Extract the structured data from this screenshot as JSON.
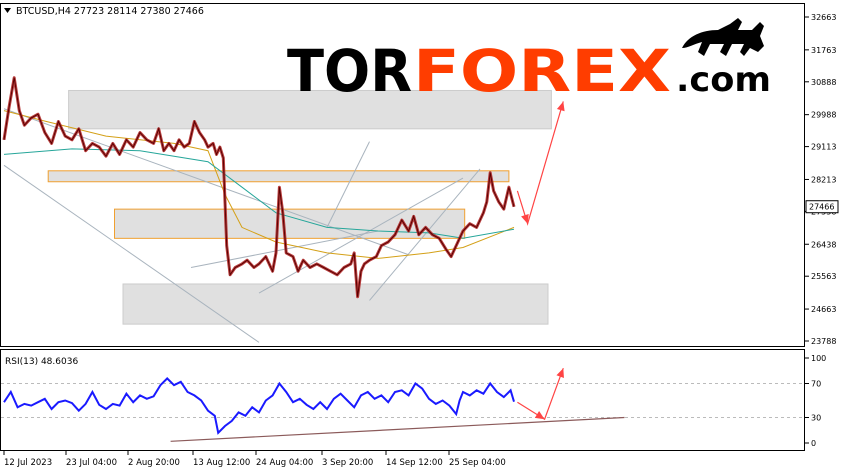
{
  "chart_data": [
    {
      "type": "candlestick",
      "symbol_info": "BTCUSD,H4  27723 28114 27380 27466",
      "last_price_label": "27466",
      "y_ticks": [
        "32663",
        "31763",
        "30888",
        "29988",
        "29113",
        "28213",
        "27338",
        "26438",
        "25563",
        "24663",
        "23788"
      ],
      "ylim": [
        23788,
        32663
      ],
      "x_ticks": [
        "12 Jul 2023",
        "23 Jul 04:00",
        "2 Aug 20:00",
        "13 Aug 12:00",
        "24 Aug 04:00",
        "3 Sep 20:00",
        "14 Sep 12:00",
        "25 Sep 04:00"
      ],
      "price_path": [
        [
          0,
          29300
        ],
        [
          3,
          30200
        ],
        [
          6,
          31000
        ],
        [
          9,
          30100
        ],
        [
          12,
          29700
        ],
        [
          16,
          29900
        ],
        [
          20,
          30000
        ],
        [
          24,
          29500
        ],
        [
          28,
          29200
        ],
        [
          32,
          29800
        ],
        [
          36,
          29400
        ],
        [
          40,
          29300
        ],
        [
          44,
          29600
        ],
        [
          48,
          29000
        ],
        [
          52,
          29200
        ],
        [
          56,
          29100
        ],
        [
          60,
          28850
        ],
        [
          64,
          29200
        ],
        [
          68,
          28900
        ],
        [
          72,
          29300
        ],
        [
          76,
          29100
        ],
        [
          80,
          29500
        ],
        [
          84,
          29300
        ],
        [
          88,
          29200
        ],
        [
          91,
          29600
        ],
        [
          94,
          29000
        ],
        [
          97,
          29200
        ],
        [
          100,
          29000
        ],
        [
          103,
          29300
        ],
        [
          106,
          29100
        ],
        [
          109,
          29200
        ],
        [
          112,
          29800
        ],
        [
          115,
          29500
        ],
        [
          118,
          29300
        ],
        [
          120,
          29100
        ],
        [
          123,
          29200
        ],
        [
          125,
          28900
        ],
        [
          127,
          29100
        ],
        [
          129,
          28800
        ],
        [
          131,
          26400
        ],
        [
          133,
          25600
        ],
        [
          136,
          25800
        ],
        [
          140,
          25900
        ],
        [
          143,
          26000
        ],
        [
          147,
          25800
        ],
        [
          150,
          25900
        ],
        [
          154,
          26100
        ],
        [
          158,
          25700
        ],
        [
          160,
          26200
        ],
        [
          162,
          28000
        ],
        [
          164,
          27300
        ],
        [
          166,
          26200
        ],
        [
          170,
          26100
        ],
        [
          173,
          25700
        ],
        [
          176,
          26000
        ],
        [
          180,
          25800
        ],
        [
          184,
          25900
        ],
        [
          188,
          25800
        ],
        [
          192,
          25700
        ],
        [
          196,
          25600
        ],
        [
          200,
          25800
        ],
        [
          204,
          25900
        ],
        [
          206,
          26200
        ],
        [
          208,
          25000
        ],
        [
          210,
          25700
        ],
        [
          212,
          25900
        ],
        [
          215,
          26000
        ],
        [
          219,
          26100
        ],
        [
          222,
          26400
        ],
        [
          226,
          26500
        ],
        [
          230,
          26700
        ],
        [
          234,
          27100
        ],
        [
          238,
          26800
        ],
        [
          241,
          27200
        ],
        [
          244,
          26700
        ],
        [
          248,
          26900
        ],
        [
          252,
          26700
        ],
        [
          256,
          26600
        ],
        [
          260,
          26300
        ],
        [
          263,
          26100
        ],
        [
          266,
          26400
        ],
        [
          270,
          26800
        ],
        [
          274,
          27000
        ],
        [
          278,
          26900
        ],
        [
          282,
          27300
        ],
        [
          284,
          27600
        ],
        [
          286,
          28400
        ],
        [
          288,
          27900
        ],
        [
          291,
          27600
        ],
        [
          294,
          27400
        ],
        [
          297,
          28000
        ],
        [
          300,
          27466
        ]
      ],
      "moving_averages": [
        {
          "color": "#d4a017",
          "points": [
            [
              0,
              30100
            ],
            [
              25,
              29800
            ],
            [
              60,
              29400
            ],
            [
              100,
              29200
            ],
            [
              120,
              29000
            ],
            [
              130,
              27800
            ],
            [
              140,
              26900
            ],
            [
              160,
              26500
            ],
            [
              190,
              26200
            ],
            [
              220,
              26050
            ],
            [
              250,
              26200
            ],
            [
              270,
              26350
            ],
            [
              300,
              26900
            ]
          ]
        },
        {
          "color": "#26a69a",
          "points": [
            [
              0,
              28900
            ],
            [
              40,
              29050
            ],
            [
              80,
              29000
            ],
            [
              120,
              28700
            ],
            [
              140,
              28000
            ],
            [
              160,
              27300
            ],
            [
              190,
              26900
            ],
            [
              220,
              26800
            ],
            [
              250,
              26750
            ],
            [
              270,
              26600
            ],
            [
              300,
              26850
            ]
          ]
        }
      ],
      "channel_lines": [
        {
          "from": [
            0,
            30150
          ],
          "to": [
            238,
            26150
          ]
        },
        {
          "from": [
            0,
            28600
          ],
          "to": [
            150,
            23750
          ]
        },
        {
          "from": [
            110,
            25800
          ],
          "to": [
            220,
            26800
          ]
        },
        {
          "from": [
            150,
            25100
          ],
          "to": [
            270,
            28250
          ]
        },
        {
          "from": [
            190,
            26900
          ],
          "to": [
            215,
            29250
          ]
        },
        {
          "from": [
            215,
            24900
          ],
          "to": [
            280,
            28500
          ]
        }
      ],
      "zones": [
        {
          "low": 29600,
          "high": 30650,
          "x0": 38,
          "x1": 322,
          "edge": "#cccccc"
        },
        {
          "low": 28150,
          "high": 28450,
          "x0": 26,
          "x1": 297,
          "edge": "#f0a030"
        },
        {
          "low": 26600,
          "high": 27400,
          "x0": 65,
          "x1": 271,
          "edge": "#f0a030"
        },
        {
          "low": 24250,
          "high": 25350,
          "x0": 70,
          "x1": 320,
          "edge": "#cccccc"
        }
      ],
      "forecast_arrow": [
        [
          302,
          27900
        ],
        [
          308,
          27000
        ],
        [
          329,
          30350
        ]
      ]
    },
    {
      "type": "line",
      "label": "RSI(13) 48.6036",
      "y_ticks": [
        100,
        70,
        30,
        0
      ],
      "ylim": [
        0,
        100
      ],
      "values": [
        [
          0,
          48
        ],
        [
          4,
          60
        ],
        [
          8,
          42
        ],
        [
          12,
          46
        ],
        [
          16,
          44
        ],
        [
          20,
          48
        ],
        [
          24,
          52
        ],
        [
          28,
          40
        ],
        [
          32,
          48
        ],
        [
          36,
          50
        ],
        [
          40,
          47
        ],
        [
          44,
          38
        ],
        [
          48,
          46
        ],
        [
          52,
          60
        ],
        [
          56,
          45
        ],
        [
          60,
          40
        ],
        [
          64,
          46
        ],
        [
          68,
          44
        ],
        [
          72,
          58
        ],
        [
          76,
          48
        ],
        [
          80,
          56
        ],
        [
          84,
          52
        ],
        [
          88,
          55
        ],
        [
          92,
          68
        ],
        [
          96,
          76
        ],
        [
          100,
          68
        ],
        [
          104,
          72
        ],
        [
          108,
          60
        ],
        [
          112,
          56
        ],
        [
          116,
          50
        ],
        [
          120,
          38
        ],
        [
          124,
          32
        ],
        [
          126,
          12
        ],
        [
          130,
          20
        ],
        [
          134,
          26
        ],
        [
          138,
          36
        ],
        [
          142,
          32
        ],
        [
          146,
          42
        ],
        [
          150,
          36
        ],
        [
          154,
          50
        ],
        [
          158,
          56
        ],
        [
          162,
          70
        ],
        [
          166,
          60
        ],
        [
          170,
          48
        ],
        [
          174,
          52
        ],
        [
          178,
          45
        ],
        [
          182,
          40
        ],
        [
          186,
          48
        ],
        [
          190,
          40
        ],
        [
          194,
          52
        ],
        [
          198,
          58
        ],
        [
          202,
          50
        ],
        [
          206,
          42
        ],
        [
          210,
          56
        ],
        [
          214,
          60
        ],
        [
          218,
          52
        ],
        [
          222,
          56
        ],
        [
          226,
          48
        ],
        [
          230,
          60
        ],
        [
          234,
          62
        ],
        [
          238,
          56
        ],
        [
          242,
          70
        ],
        [
          246,
          64
        ],
        [
          250,
          52
        ],
        [
          254,
          46
        ],
        [
          258,
          50
        ],
        [
          262,
          44
        ],
        [
          266,
          34
        ],
        [
          268,
          50
        ],
        [
          270,
          60
        ],
        [
          274,
          56
        ],
        [
          278,
          62
        ],
        [
          282,
          58
        ],
        [
          286,
          70
        ],
        [
          290,
          60
        ],
        [
          294,
          54
        ],
        [
          298,
          62
        ],
        [
          300,
          48.6036
        ]
      ],
      "trendline": {
        "from": [
          98,
          2
        ],
        "to": [
          365,
          30
        ]
      },
      "forecast_arrow": [
        [
          302,
          48
        ],
        [
          318,
          28
        ],
        [
          329,
          88
        ]
      ]
    }
  ],
  "branding": {
    "logo_part1": "TOR",
    "logo_part2": "FOREX",
    "logo_part3": ".com"
  }
}
